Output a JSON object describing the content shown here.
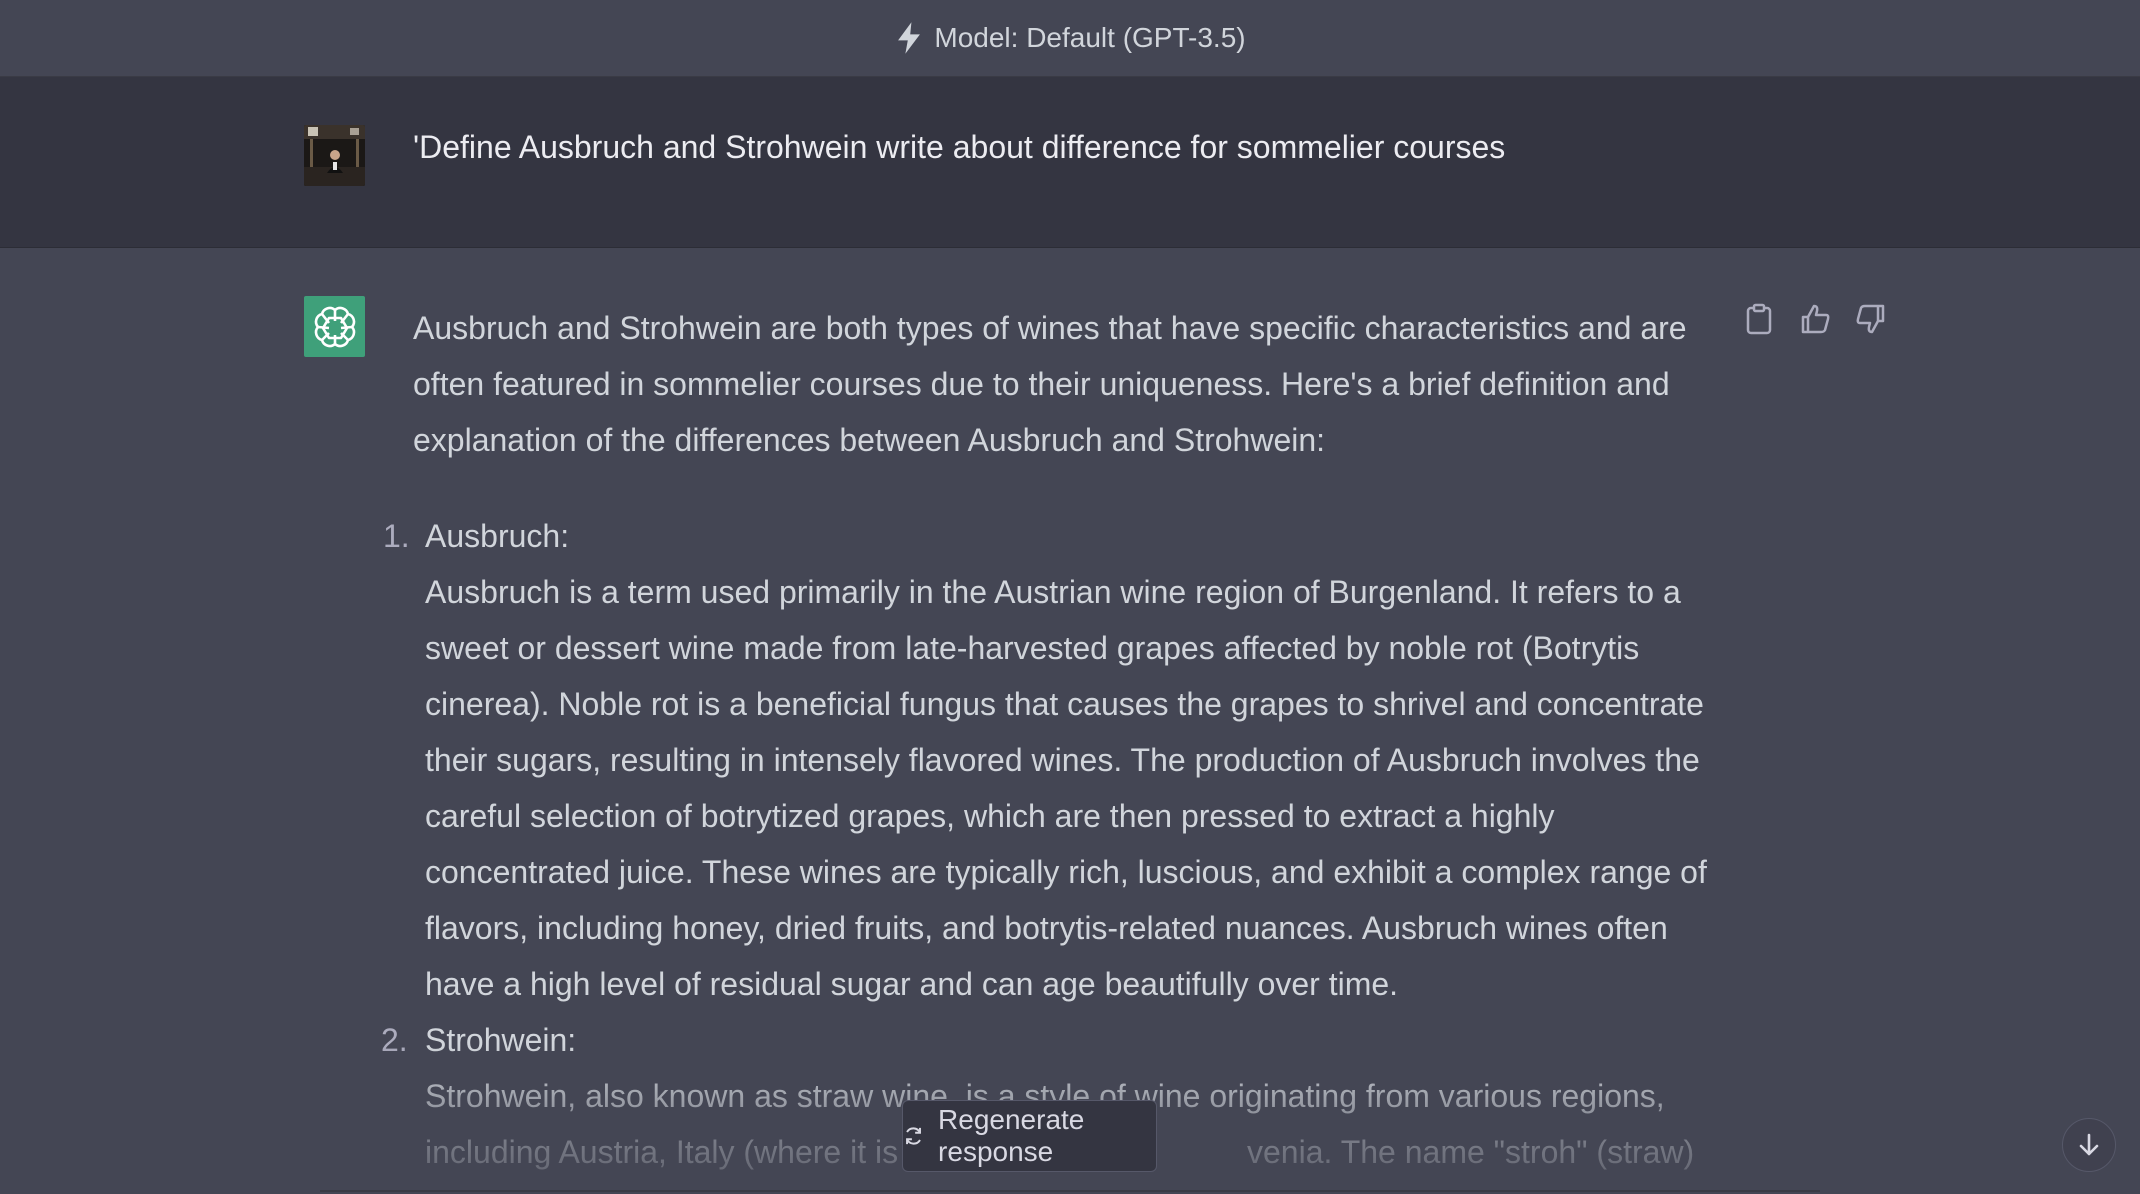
{
  "header": {
    "model_label": "Model: Default (GPT-3.5)",
    "icon": "lightning-bolt-icon"
  },
  "user_message": {
    "avatar": "user-avatar-photo",
    "text": "'Define Ausbruch and Strohwein write about difference for sommelier courses"
  },
  "assistant_message": {
    "avatar": "openai-logo-icon",
    "intro": "Ausbruch and Strohwein are both types of wines that have specific characteristics and are often featured in sommelier courses due to their uniqueness. Here's a brief definition and explanation of the differences between Ausbruch and Strohwein:",
    "items": [
      {
        "number": "1.",
        "title": "Ausbruch:",
        "body": "Ausbruch is a term used primarily in the Austrian wine region of Burgenland. It refers to a sweet or dessert wine made from late-harvested grapes affected by noble rot (Botrytis cinerea). Noble rot is a beneficial fungus that causes the grapes to shrivel and concentrate their sugars, resulting in intensely flavored wines. The production of Ausbruch involves the careful selection of botrytized grapes, which are then pressed to extract a highly concentrated juice. These wines are typically rich, luscious, and exhibit a complex range of flavors, including honey, dried fruits, and botrytis-related nuances. Ausbruch wines often have a high level of residual sugar and can age beautifully over time."
      },
      {
        "number": "2.",
        "title": "Strohwein:",
        "body": "Strohwein, also known as straw wine, is a style of wine originating from various regions, including Austria, Italy (where it is",
        "body_tail": "venia. The name \"stroh\" (straw)"
      }
    ]
  },
  "actions": {
    "copy": "clipboard-icon",
    "like": "thumbs-up-icon",
    "dislike": "thumbs-down-icon"
  },
  "footer": {
    "regenerate_label": "Regenerate response",
    "regenerate_icon": "refresh-icon",
    "scroll_icon": "arrow-down-icon"
  },
  "colors": {
    "background_assistant": "#444654",
    "background_user": "#343541",
    "brand_green": "#3fa07a"
  }
}
